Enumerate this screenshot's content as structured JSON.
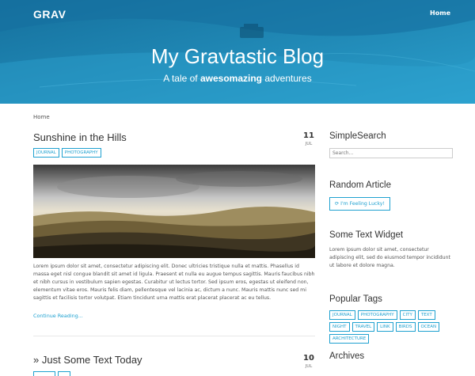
{
  "header": {
    "logo": "GRAV",
    "nav_home": "Home",
    "title": "My Gravtastic Blog",
    "subtitle_prefix": "A tale of ",
    "subtitle_bold": "awesomazing",
    "subtitle_suffix": " adventures"
  },
  "breadcrumb": "Home",
  "posts": [
    {
      "title": "Sunshine in the Hills",
      "day": "11",
      "month": "JUL",
      "tags": [
        "JOURNAL",
        "PHOTOGRAPHY"
      ],
      "body": "Lorem ipsum dolor sit amet, consectetur adipiscing elit. Donec ultricies tristique nulla et mattis. Phasellus id massa eget nisl congue blandit sit amet id ligula. Praesent et nulla eu augue tempus sagittis. Mauris faucibus nibh et nibh cursus in vestibulum sapien egestas. Curabitur ut lectus tortor. Sed ipsum eros, egestas ut eleifend non, elementum vitae eros. Mauris felis diam, pellentesque vel lacinia ac, dictum a nunc. Mauris mattis nunc sed mi sagittis et facilisis tortor volutpat. Etiam tincidunt urna mattis erat placerat placerat ac eu tellus.",
      "read_more": "Continue Reading..."
    },
    {
      "title": "Just Some Text Today",
      "day": "10",
      "month": "JUL"
    }
  ],
  "sidebar": {
    "search_title": "SimpleSearch",
    "search_placeholder": "Search...",
    "random_title": "Random Article",
    "random_button": "I'm Feeling Lucky!",
    "text_widget_title": "Some Text Widget",
    "text_widget_body": "Lorem ipsum dolor sit amet, consectetur adipiscing elit, sed do eiusmod tempor incididunt ut labore et dolore magna.",
    "tags_title": "Popular Tags",
    "tags": [
      "JOURNAL",
      "PHOTOGRAPHY",
      "CITY",
      "TEXT",
      "NIGHT",
      "TRAVEL",
      "LINK",
      "BIRDS",
      "OCEAN",
      "ARCHITECTURE"
    ],
    "archives_title": "Archives"
  },
  "colors": {
    "accent": "#1fa1d0",
    "hero": "#1f8fbf"
  }
}
